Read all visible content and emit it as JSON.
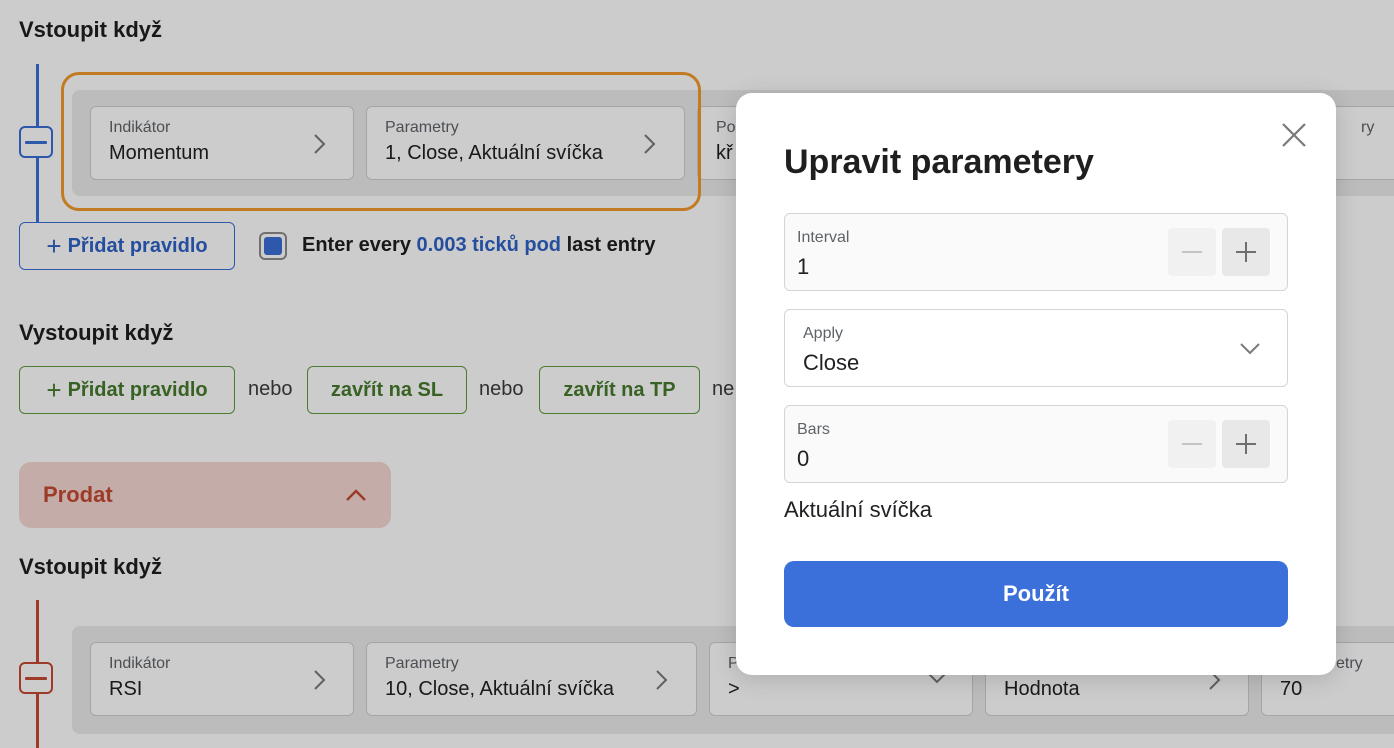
{
  "colors": {
    "buy_accent": "#3a6fd8",
    "sell_accent": "#c54a32",
    "green": "#467b2c",
    "highlight": "#f39a2c",
    "primary_button": "#3b6fd9"
  },
  "entry_buy": {
    "title": "Vstoupit když",
    "rule": {
      "indicator_label": "Indikátor",
      "indicator_value": "Momentum",
      "params_label": "Parametry",
      "params_value": "1, Close, Aktuální svíčka",
      "partial_label": "Po",
      "partial_value": "kř",
      "partial_label_right": "ry"
    },
    "add_rule": "Přidat pravidlo",
    "enter_every": {
      "prefix": "Enter every",
      "link": "0.003 ticků pod",
      "suffix": "last entry",
      "checked": true
    }
  },
  "exit_buy": {
    "title": "Vystoupit když",
    "add_rule": "Přidat pravidlo",
    "or1": "nebo",
    "close_sl": "zavřít na SL",
    "or2": "nebo",
    "close_tp": "zavřít na TP",
    "or3_partial": "ne"
  },
  "sell_section": {
    "label": "Prodat",
    "expanded": true
  },
  "entry_sell": {
    "title": "Vstoupit když",
    "rule": {
      "indicator_label": "Indikátor",
      "indicator_value": "RSI",
      "params_label": "Parametry",
      "params_value": "10, Close, Aktuální svíčka",
      "op_label": "P",
      "op_value": ">",
      "cmp_value": "Hodnota",
      "right_label": "etry",
      "right_value": "70"
    }
  },
  "modal": {
    "title": "Upravit parametery",
    "fields": [
      {
        "label": "Interval",
        "value": "1"
      },
      {
        "label": "Apply",
        "value": "Close"
      },
      {
        "label": "Bars",
        "value": "0"
      }
    ],
    "note": "Aktuální svíčka",
    "apply_label": "Použít"
  }
}
